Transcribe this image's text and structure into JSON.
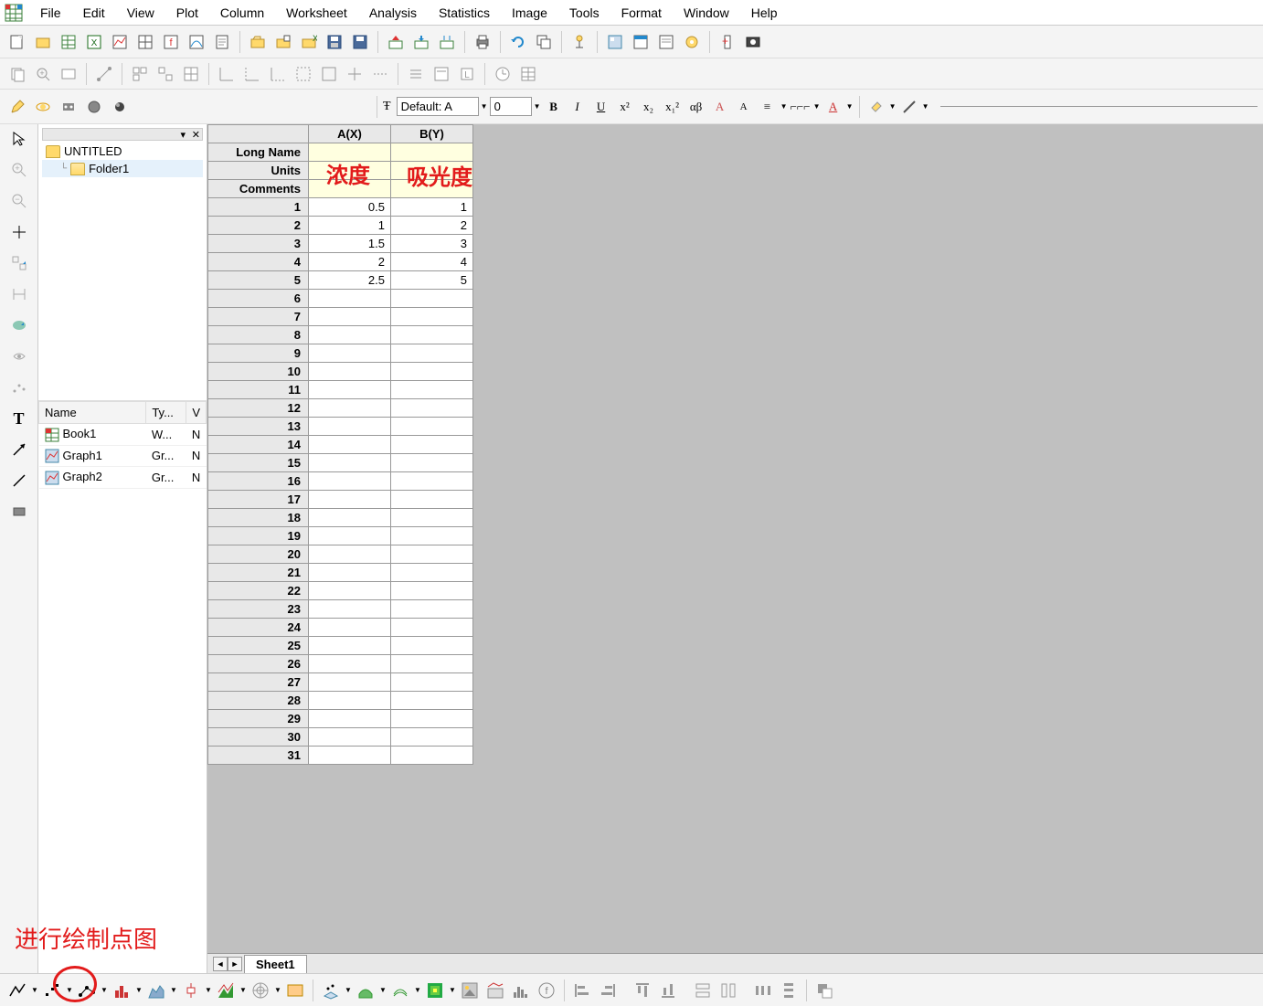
{
  "menu": [
    "File",
    "Edit",
    "View",
    "Plot",
    "Column",
    "Worksheet",
    "Analysis",
    "Statistics",
    "Image",
    "Tools",
    "Format",
    "Window",
    "Help"
  ],
  "font_toolbar": {
    "font_label": "Default: A",
    "size": "0"
  },
  "project_tree": {
    "root": "UNTITLED",
    "child": "Folder1"
  },
  "object_list": {
    "headers": [
      "Name",
      "Ty...",
      "V"
    ],
    "items": [
      {
        "name": "Book1",
        "type": "W...",
        "v": "N"
      },
      {
        "name": "Graph1",
        "type": "Gr...",
        "v": "N"
      },
      {
        "name": "Graph2",
        "type": "Gr...",
        "v": "N"
      }
    ]
  },
  "worksheet": {
    "columns": [
      "A(X)",
      "B(Y)"
    ],
    "meta_rows": [
      "Long Name",
      "Units",
      "Comments"
    ],
    "data": [
      {
        "row": 1,
        "a": "0.5",
        "b": "1"
      },
      {
        "row": 2,
        "a": "1",
        "b": "2"
      },
      {
        "row": 3,
        "a": "1.5",
        "b": "3"
      },
      {
        "row": 4,
        "a": "2",
        "b": "4"
      },
      {
        "row": 5,
        "a": "2.5",
        "b": "5"
      }
    ],
    "empty_rows": [
      6,
      7,
      8,
      9,
      10,
      11,
      12,
      13,
      14,
      15,
      16,
      17,
      18,
      19,
      20,
      21,
      22,
      23,
      24,
      25,
      26,
      27,
      28,
      29,
      30,
      31
    ],
    "sheet_tab": "Sheet1"
  },
  "annotations": {
    "col_a_label": "浓度",
    "col_b_label": "吸光度",
    "bottom_hint": "进行绘制点图"
  },
  "chart_data": {
    "type": "table",
    "columns": [
      "A(X) 浓度",
      "B(Y) 吸光度"
    ],
    "rows": [
      [
        0.5,
        1
      ],
      [
        1,
        2
      ],
      [
        1.5,
        3
      ],
      [
        2,
        4
      ],
      [
        2.5,
        5
      ]
    ]
  }
}
